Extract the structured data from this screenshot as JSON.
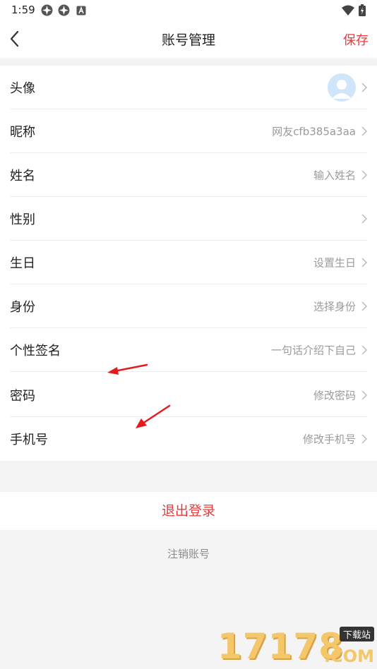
{
  "status_bar": {
    "time": "1:59"
  },
  "header": {
    "title": "账号管理",
    "save_label": "保存"
  },
  "rows": [
    {
      "label": "头像",
      "value": ""
    },
    {
      "label": "昵称",
      "value": "网友cfb385a3aa"
    },
    {
      "label": "姓名",
      "value": "输入姓名"
    },
    {
      "label": "性别",
      "value": ""
    },
    {
      "label": "生日",
      "value": "设置生日"
    },
    {
      "label": "身份",
      "value": "选择身份"
    },
    {
      "label": "个性签名",
      "value": "一句话介绍下自己"
    },
    {
      "label": "密码",
      "value": "修改密码"
    },
    {
      "label": "手机号",
      "value": "修改手机号"
    }
  ],
  "logout_label": "退出登录",
  "deactivate_label": "注销账号",
  "watermark": {
    "digits": "17178",
    "tag": "下载站",
    "suffix": ".COM"
  },
  "colors": {
    "accent": "#e83a3a",
    "annotation_arrow": "#e51b1b",
    "muted_text": "#9a9a9a"
  }
}
